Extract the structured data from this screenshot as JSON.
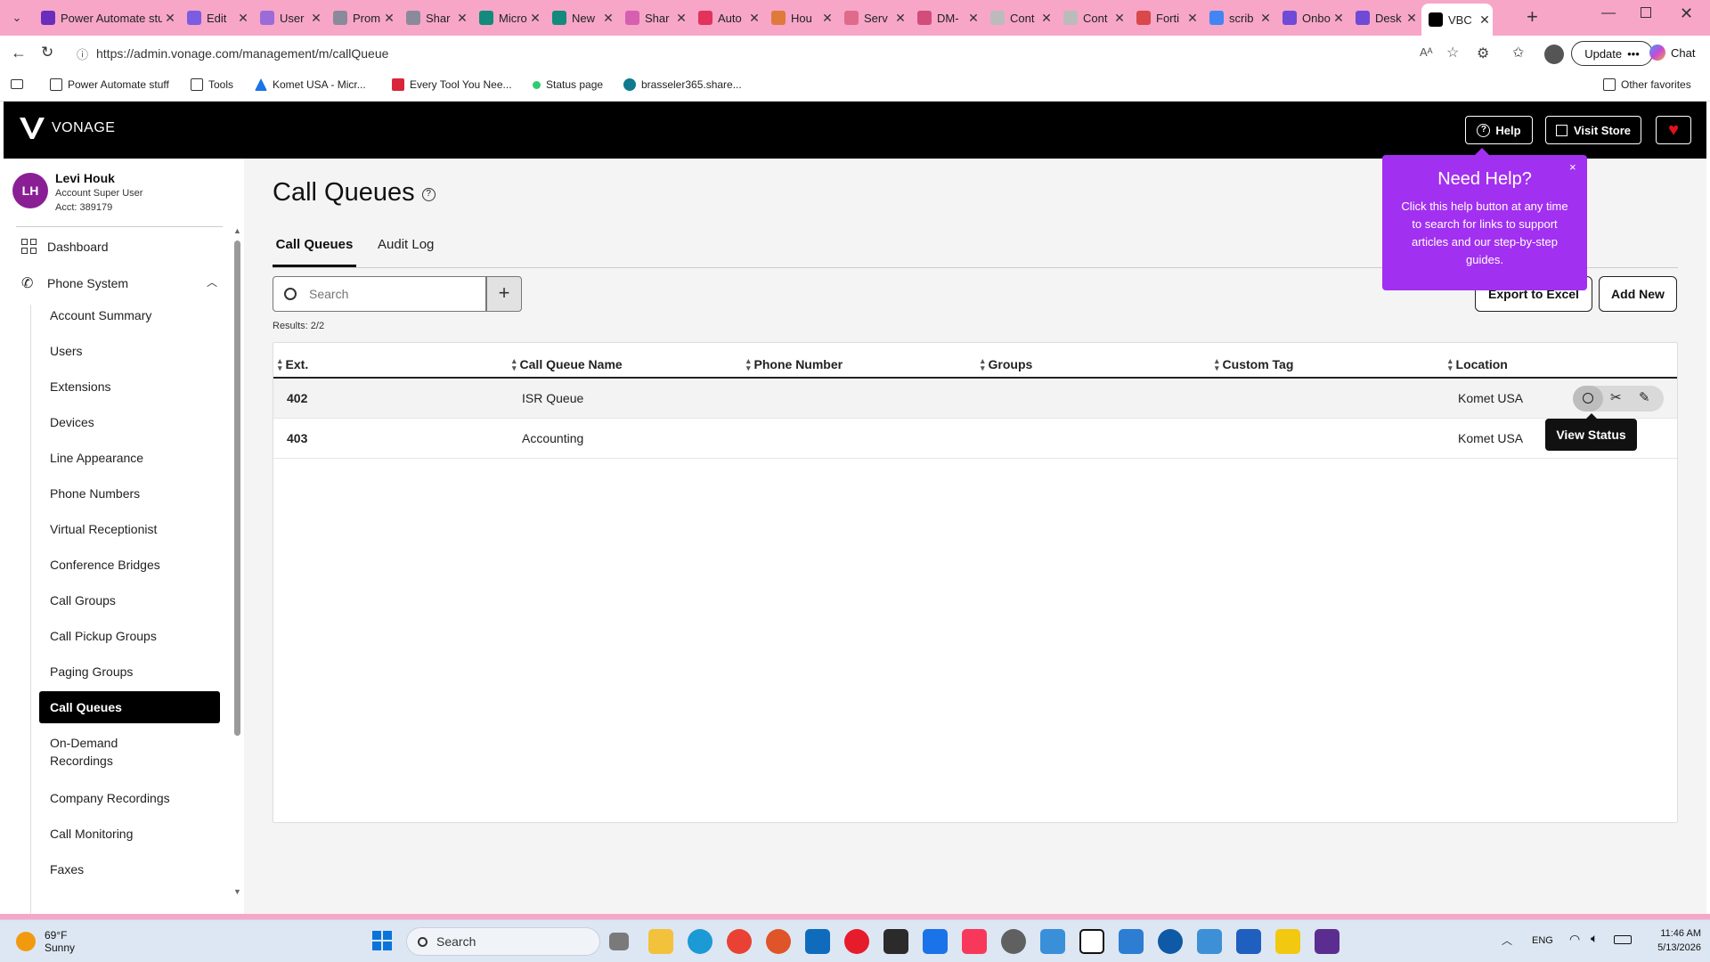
{
  "browser": {
    "tabs": [
      {
        "label": "Power Automate stuff",
        "color": "#6a2dbd"
      },
      {
        "label": "Edit",
        "color": "#7c5ce0"
      },
      {
        "label": "User",
        "color": "#9b6bd7"
      },
      {
        "label": "Prom",
        "color": "#8a8a9a"
      },
      {
        "label": "Shar",
        "color": "#8a8a9a"
      },
      {
        "label": "Micro",
        "color": "#128a7c"
      },
      {
        "label": "New",
        "color": "#128a7c"
      },
      {
        "label": "Shar",
        "color": "#d65fb0"
      },
      {
        "label": "Auto",
        "color": "#e2335a"
      },
      {
        "label": "Hou",
        "color": "#e07a3c"
      },
      {
        "label": "Serv",
        "color": "#e06a8a"
      },
      {
        "label": "DM-",
        "color": "#d24d7a"
      },
      {
        "label": "Cont",
        "color": "#bbb"
      },
      {
        "label": "Cont",
        "color": "#bbb"
      },
      {
        "label": "Forti",
        "color": "#d9484a"
      },
      {
        "label": "scrib",
        "color": "#4285f4"
      },
      {
        "label": "Onbo",
        "color": "#6f4ad6"
      },
      {
        "label": "Desk",
        "color": "#6f4ad6"
      },
      {
        "label": "VBC",
        "color": "#000000"
      }
    ],
    "url": "https://admin.vonage.com/management/m/callQueue",
    "update_label": "Update",
    "chat_label": "Chat",
    "bookmarks": [
      {
        "label": "Power Automate stuff"
      },
      {
        "label": "Tools"
      },
      {
        "label": "Komet USA - Micr..."
      },
      {
        "label": "Every Tool You Nee..."
      },
      {
        "label": "Status page"
      },
      {
        "label": "brasseler365.share..."
      }
    ],
    "other_favorites": "Other favorites"
  },
  "header": {
    "brand": "VONAGE",
    "help_label": "Help",
    "visit_store_label": "Visit Store"
  },
  "user": {
    "initials": "LH",
    "name": "Levi Houk",
    "role": "Account Super User",
    "account": "Acct: 389179"
  },
  "sidebar": {
    "dashboard": "Dashboard",
    "phone_system": "Phone System",
    "items": [
      "Account Summary",
      "Users",
      "Extensions",
      "Devices",
      "Line Appearance",
      "Phone Numbers",
      "Virtual Receptionist",
      "Conference Bridges",
      "Call Groups",
      "Call Pickup Groups",
      "Paging Groups",
      "Call Queues",
      "On-Demand Recordings",
      "Company Recordings",
      "Call Monitoring",
      "Faxes"
    ],
    "active_item": "Call Queues"
  },
  "page": {
    "title": "Call Queues",
    "tabs": [
      "Call Queues",
      "Audit Log"
    ],
    "search_placeholder": "Search",
    "results": "Results: 2/2",
    "export_label": "Export to Excel",
    "add_new_label": "Add New"
  },
  "table": {
    "columns": [
      "Ext.",
      "Call Queue Name",
      "Phone Number",
      "Groups",
      "Custom Tag",
      "Location"
    ],
    "rows": [
      {
        "ext": "402",
        "name": "ISR Queue",
        "phone": "",
        "groups": "",
        "tag": "",
        "location": "Komet USA"
      },
      {
        "ext": "403",
        "name": "Accounting",
        "phone": "",
        "groups": "",
        "tag": "",
        "location": "Komet USA"
      }
    ]
  },
  "tooltip": "View Status",
  "help_popup": {
    "title": "Need Help?",
    "body": "Click this help button at any time to search for links to support articles and our step-by-step guides.",
    "close": "×",
    "color": "#a230f0"
  },
  "taskbar": {
    "temp": "69°F",
    "weather": "Sunny",
    "search": "Search",
    "lang": "ENG",
    "time": "11:46 AM",
    "date": "5/13/2026"
  }
}
